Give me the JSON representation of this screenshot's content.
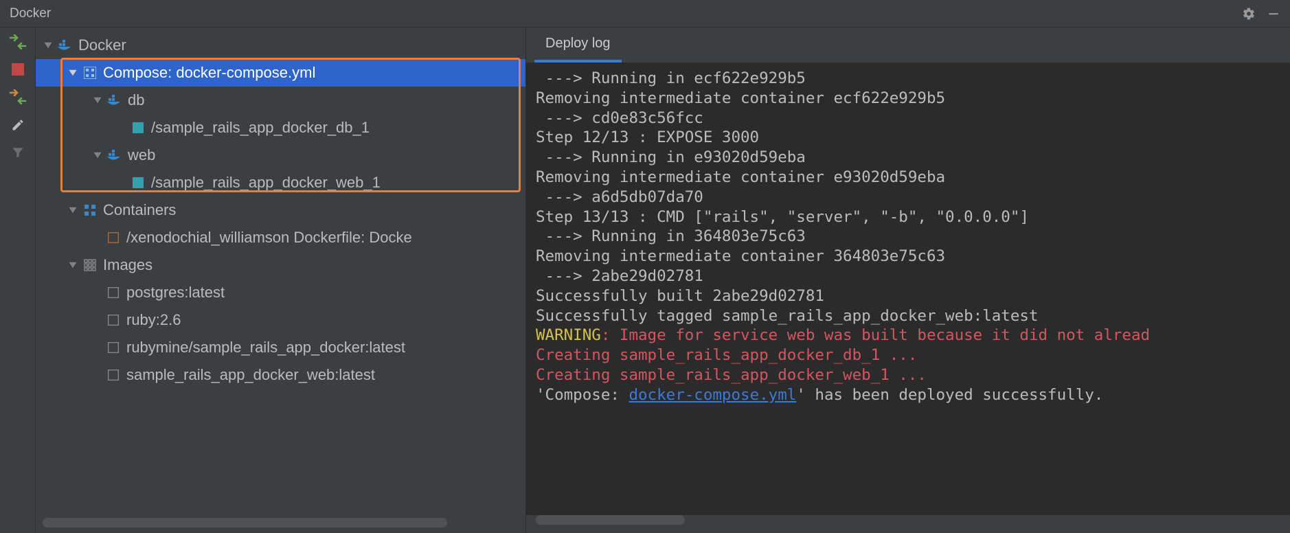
{
  "title": "Docker",
  "tabs": {
    "deploy_log": "Deploy log"
  },
  "tree": {
    "root_label": "Docker",
    "compose_label": "Compose: docker-compose.yml",
    "db_label": "db",
    "db_container": "/sample_rails_app_docker_db_1",
    "web_label": "web",
    "web_container": "/sample_rails_app_docker_web_1",
    "containers_label": "Containers",
    "container_std": "/xenodochial_williamson Dockerfile: Docke",
    "images_label": "Images",
    "img_postgres": "postgres:latest",
    "img_ruby": "ruby:2.6",
    "img_rubymine": "rubymine/sample_rails_app_docker:latest",
    "img_sample_web": "sample_rails_app_docker_web:latest"
  },
  "log": {
    "l1": " ---> Running in ecf622e929b5",
    "l2": "Removing intermediate container ecf622e929b5",
    "l3": " ---> cd0e83c56fcc",
    "l4": "Step 12/13 : EXPOSE 3000",
    "l5": " ---> Running in e93020d59eba",
    "l6": "Removing intermediate container e93020d59eba",
    "l7": " ---> a6d5db07da70",
    "l8": "Step 13/13 : CMD [\"rails\", \"server\", \"-b\", \"0.0.0.0\"]",
    "l9": " ---> Running in 364803e75c63",
    "l10": "Removing intermediate container 364803e75c63",
    "l11": " ---> 2abe29d02781",
    "l12": "Successfully built 2abe29d02781",
    "l13": "Successfully tagged sample_rails_app_docker_web:latest",
    "warn_prefix": "WARNING",
    "warn_rest": ": Image for service web was built because it did not alread",
    "create_db": "Creating sample_rails_app_docker_db_1 ...",
    "create_web": "Creating sample_rails_app_docker_web_1 ...",
    "final_prefix": "'Compose: ",
    "final_link": "docker-compose.yml",
    "final_suffix": "' has been deployed successfully."
  }
}
